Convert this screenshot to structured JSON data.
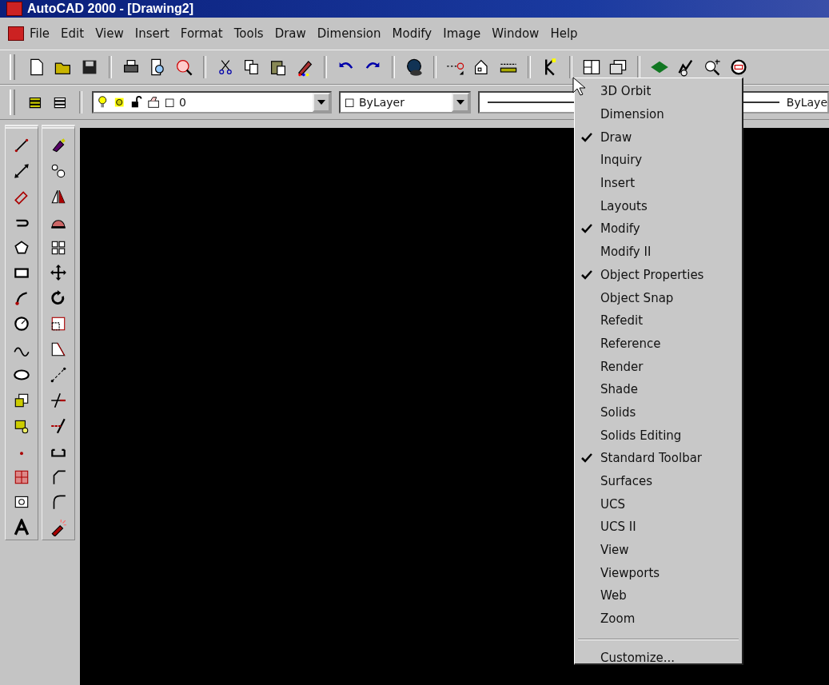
{
  "window": {
    "title": "AutoCAD 2000 - [Drawing2]"
  },
  "menu_bar": [
    "File",
    "Edit",
    "View",
    "Insert",
    "Format",
    "Tools",
    "Draw",
    "Dimension",
    "Modify",
    "Image",
    "Window",
    "Help"
  ],
  "properties_toolbar": {
    "layer": "0",
    "color_setting": "ByLayer",
    "linetype": "ByLaye"
  },
  "toolbars_menu": {
    "items": [
      {
        "label": "3D Orbit",
        "checked": false
      },
      {
        "label": "Dimension",
        "checked": false
      },
      {
        "label": "Draw",
        "checked": true
      },
      {
        "label": "Inquiry",
        "checked": false
      },
      {
        "label": "Insert",
        "checked": false
      },
      {
        "label": "Layouts",
        "checked": false
      },
      {
        "label": "Modify",
        "checked": true
      },
      {
        "label": "Modify II",
        "checked": false
      },
      {
        "label": "Object Properties",
        "checked": true
      },
      {
        "label": "Object Snap",
        "checked": false
      },
      {
        "label": "Refedit",
        "checked": false
      },
      {
        "label": "Reference",
        "checked": false
      },
      {
        "label": "Render",
        "checked": false
      },
      {
        "label": "Shade",
        "checked": false
      },
      {
        "label": "Solids",
        "checked": false
      },
      {
        "label": "Solids Editing",
        "checked": false
      },
      {
        "label": "Standard Toolbar",
        "checked": true
      },
      {
        "label": "Surfaces",
        "checked": false
      },
      {
        "label": "UCS",
        "checked": false
      },
      {
        "label": "UCS II",
        "checked": false
      },
      {
        "label": "View",
        "checked": false
      },
      {
        "label": "Viewports",
        "checked": false
      },
      {
        "label": "Web",
        "checked": false
      },
      {
        "label": "Zoom",
        "checked": false
      }
    ],
    "footer": "Customize..."
  }
}
